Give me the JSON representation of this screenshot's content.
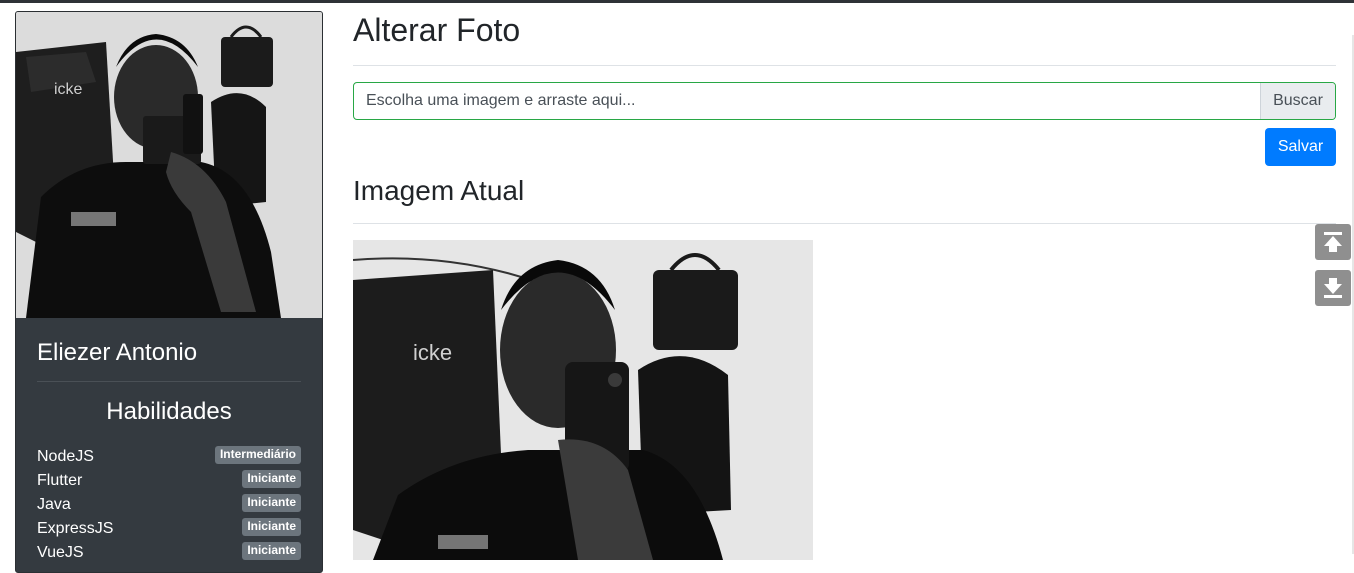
{
  "profile": {
    "name": "Eliezer Antonio",
    "skills_title": "Habilidades",
    "skills": [
      {
        "name": "NodeJS",
        "level": "Intermediário"
      },
      {
        "name": "Flutter",
        "level": "Iniciante"
      },
      {
        "name": "Java",
        "level": "Iniciante"
      },
      {
        "name": "ExpressJS",
        "level": "Iniciante"
      },
      {
        "name": "VueJS",
        "level": "Iniciante"
      }
    ]
  },
  "change_photo": {
    "title": "Alterar Foto",
    "file_placeholder": "Escolha uma imagem e arraste aqui...",
    "browse_label": "Buscar",
    "save_label": "Salvar"
  },
  "current_image": {
    "title": "Imagem Atual"
  },
  "side_controls": {
    "up_icon": "arrow-up-bar-icon",
    "down_icon": "arrow-down-bar-icon"
  },
  "colors": {
    "card_bg": "#343a40",
    "primary": "#007bff",
    "success_border": "#28a745",
    "badge": "#6c757d"
  }
}
